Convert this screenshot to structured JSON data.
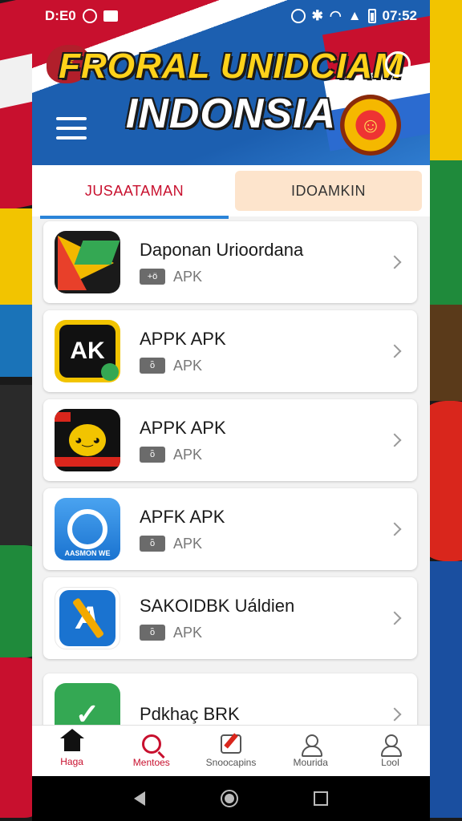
{
  "status_bar": {
    "time_left": "D:E0",
    "time_right": "07:52"
  },
  "header": {
    "title_line1": "FRORAL UNIDCIAM",
    "title_line2": "INDONSIA"
  },
  "tabs": [
    {
      "label": "JUSAATAMAN",
      "active": true
    },
    {
      "label": "IDOAMKIN",
      "active": false
    }
  ],
  "apps": [
    {
      "name": "Daponan Urioordana",
      "meta": "APK",
      "badge": "+ö"
    },
    {
      "name": "APPK APK",
      "meta": "APK",
      "badge": "ὃ"
    },
    {
      "name": "APPK APK",
      "meta": "APK",
      "badge": "ὃ"
    },
    {
      "name": "APFK APK",
      "meta": "APK",
      "badge": "ὃ"
    },
    {
      "name": "SAKOIDBK Uáldien",
      "meta": "APK",
      "badge": "ὃ"
    },
    {
      "name": "Pdkhaç BRK",
      "meta": "",
      "badge": ""
    }
  ],
  "icons": {
    "app2_text": "AK",
    "app4_caption": "AASMON WE",
    "app5_text": "A"
  },
  "bottom_nav": [
    {
      "label": "Haga",
      "icon": "home-icon"
    },
    {
      "label": "Mentoes",
      "icon": "search-icon"
    },
    {
      "label": "Snoocapins",
      "icon": "edit-icon"
    },
    {
      "label": "Mourida",
      "icon": "user-location-icon"
    },
    {
      "label": "Lool",
      "icon": "profile-icon"
    }
  ],
  "colors": {
    "accent_red": "#c8102e",
    "tab_underline": "#2a84d8",
    "inactive_tab_bg": "#fde4cc"
  }
}
